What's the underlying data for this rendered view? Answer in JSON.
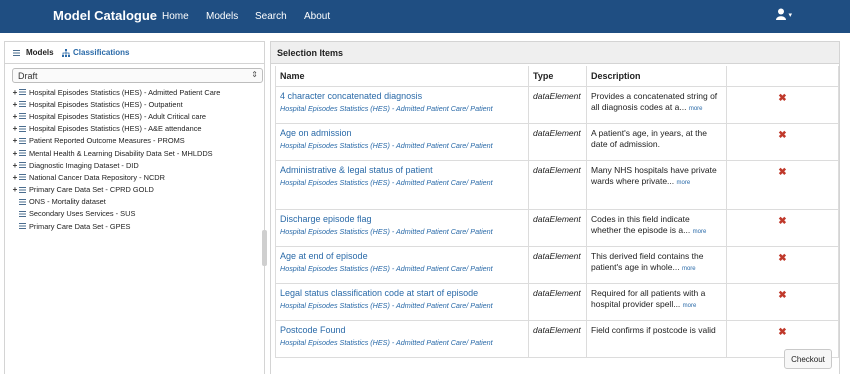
{
  "navbar": {
    "brand": "Model Catalogue",
    "links": [
      "Home",
      "Models",
      "Search",
      "About"
    ],
    "user_caret": "▾"
  },
  "sidebar": {
    "tabs": [
      "Models",
      "Classifications"
    ],
    "select_value": "Draft",
    "items": [
      {
        "label": "Hospital Episodes Statistics (HES) - Admitted Patient Care",
        "expandable": true
      },
      {
        "label": "Hospital Episodes Statistics (HES) - Outpatient",
        "expandable": true
      },
      {
        "label": "Hospital Episodes Statistics (HES) - Adult Critical care",
        "expandable": true
      },
      {
        "label": "Hospital Episodes Statistics (HES) - A&E attendance",
        "expandable": true
      },
      {
        "label": "Patient Reported Outcome Measures - PROMS",
        "expandable": true
      },
      {
        "label": "Mental Health & Learning Disability Data Set - MHLDDS",
        "expandable": true
      },
      {
        "label": "Diagnostic Imaging Dataset - DID",
        "expandable": true
      },
      {
        "label": "National Cancer Data Repository - NCDR",
        "expandable": true
      },
      {
        "label": "Primary Care Data Set - CPRD GOLD",
        "expandable": true
      },
      {
        "label": "ONS - Mortality dataset",
        "expandable": false
      },
      {
        "label": "Secondary Uses Services - SUS",
        "expandable": false
      },
      {
        "label": "Primary Care Data Set - GPES",
        "expandable": false
      }
    ]
  },
  "main": {
    "heading": "Selection Items",
    "columns": [
      "Name",
      "Type",
      "Description"
    ],
    "more_label": "more",
    "checkout_label": "Checkout",
    "rows": [
      {
        "name": "4 character concatenated diagnosis",
        "path": "Hospital Episodes Statistics (HES) - Admitted Patient Care/ Patient",
        "type": "dataElement",
        "desc": "Provides a concatenated string of all diagnosis codes at a...",
        "more": true
      },
      {
        "name": "Age on admission",
        "path": "Hospital Episodes Statistics (HES) - Admitted Patient Care/ Patient",
        "type": "dataElement",
        "desc": "A patient's age, in years, at the date of admission.",
        "more": false
      },
      {
        "name": "Administrative & legal status of patient",
        "path": "Hospital Episodes Statistics (HES) - Admitted Patient Care/ Patient",
        "type": "dataElement",
        "desc": "Many NHS hospitals have private wards where private...",
        "more": true
      },
      {
        "name": "Discharge episode flag",
        "path": "Hospital Episodes Statistics (HES) - Admitted Patient Care/ Patient",
        "type": "dataElement",
        "desc": "Codes in this field indicate whether the episode is a...",
        "more": true
      },
      {
        "name": "Age at end of episode",
        "path": "Hospital Episodes Statistics (HES) - Admitted Patient Care/ Patient",
        "type": "dataElement",
        "desc": "This derived field contains the patient's age in whole...",
        "more": true
      },
      {
        "name": "Legal status classification code at start of episode",
        "path": "Hospital Episodes Statistics (HES) - Admitted Patient Care/ Patient",
        "type": "dataElement",
        "desc": "Required for all patients with a hospital provider spell...",
        "more": true
      },
      {
        "name": "Postcode Found",
        "path": "Hospital Episodes Statistics (HES) - Admitted Patient Care/ Patient",
        "type": "dataElement",
        "desc": "Field confirms if postcode is valid",
        "more": false
      }
    ]
  }
}
